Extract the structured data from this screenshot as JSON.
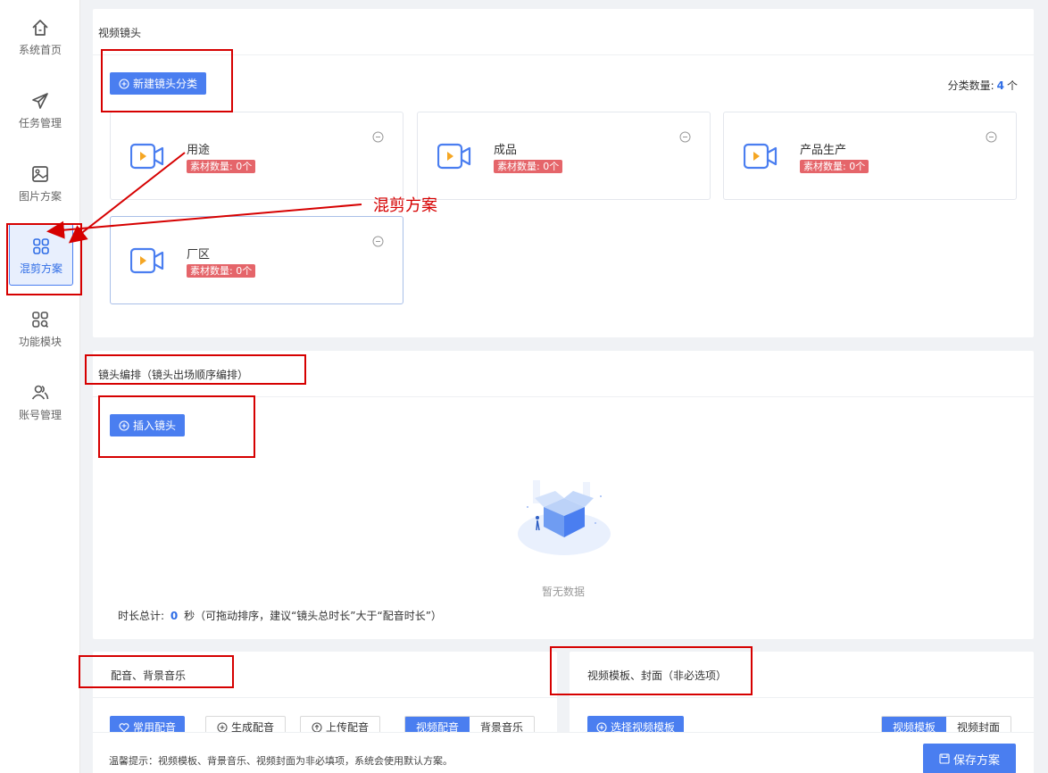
{
  "sidebar": {
    "items": [
      {
        "label": "系统首页",
        "icon": "home-icon"
      },
      {
        "label": "任务管理",
        "icon": "send-icon"
      },
      {
        "label": "图片方案",
        "icon": "image-icon"
      },
      {
        "label": "混剪方案",
        "icon": "grid-icon",
        "active": true
      },
      {
        "label": "功能模块",
        "icon": "modules-icon"
      },
      {
        "label": "账号管理",
        "icon": "users-icon"
      }
    ]
  },
  "shots": {
    "title": "视频镜头",
    "new_category_label": "新建镜头分类",
    "count_label": "分类数量:",
    "count_value": "4",
    "count_unit": "个",
    "categories": [
      {
        "name": "用途",
        "badge": "素材数量: 0个"
      },
      {
        "name": "成品",
        "badge": "素材数量: 0个"
      },
      {
        "name": "产品生产",
        "badge": "素材数量: 0个"
      },
      {
        "name": "厂区",
        "badge": "素材数量: 0个"
      }
    ]
  },
  "annotation": {
    "text": "混剪方案"
  },
  "arrange": {
    "title": "镜头编排（镜头出场顺序编排）",
    "insert_label": "插入镜头",
    "empty_text": "暂无数据",
    "duration_prefix": "时长总计:",
    "duration_value": "0",
    "duration_suffix": "秒（可拖动排序，建议“镜头总时长”大于“配音时长”）"
  },
  "audio": {
    "title": "配音、背景音乐",
    "buttons": {
      "common": "常用配音",
      "generate": "生成配音",
      "upload": "上传配音"
    },
    "tabs": [
      "视频配音",
      "背景音乐"
    ]
  },
  "template": {
    "title": "视频模板、封面（非必选项）",
    "select_label": "选择视频模板",
    "tabs": [
      "视频模板",
      "视频封面"
    ]
  },
  "footer": {
    "tip": "温馨提示：视频模板、背景音乐、视频封面为非必填项，系统会使用默认方案。",
    "save_label": "保存方案"
  },
  "colors": {
    "primary": "#4a7ef0",
    "badge": "#e5656a",
    "annotation_red": "#d60000",
    "camera_orange": "#f5a623"
  }
}
